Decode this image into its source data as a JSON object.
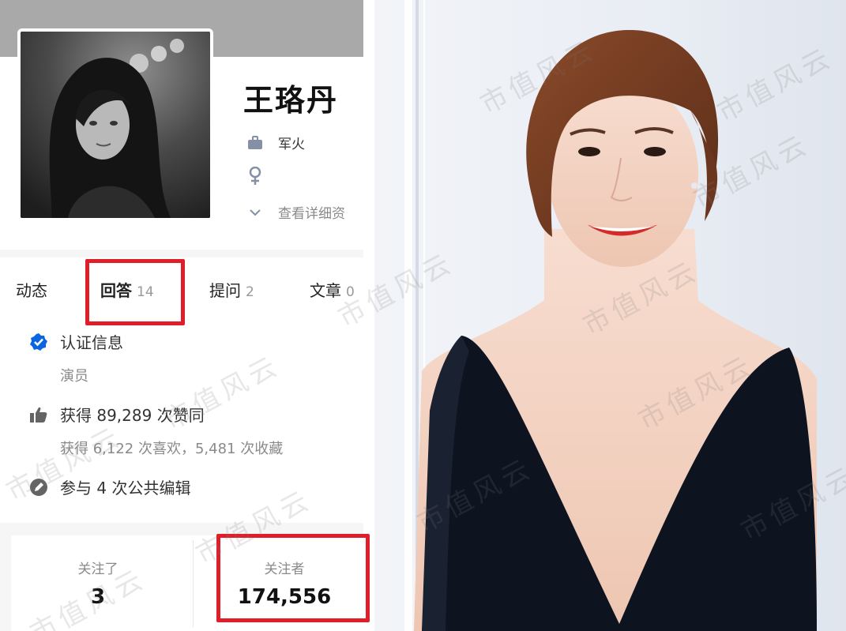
{
  "profile": {
    "name": "王珞丹",
    "job": "军火",
    "gender_icon": "female-icon",
    "more_info": "查看详细资",
    "avatar_desc": "black-and-white portrait"
  },
  "tabs": [
    {
      "label": "动态",
      "count": ""
    },
    {
      "label": "回答",
      "count": "14"
    },
    {
      "label": "提问",
      "count": "2"
    },
    {
      "label": "文章",
      "count": "0"
    }
  ],
  "details": {
    "verified_label": "认证信息",
    "verified_role": "演员",
    "likes": "获得 89,289 次赞同",
    "favorites": "获得 6,122 次喜欢，5,481 次收藏",
    "edits": "参与 4 次公共编辑"
  },
  "follow": {
    "following_label": "关注了",
    "following_count": "3",
    "followers_label": "关注者",
    "followers_count": "174,556"
  },
  "watermark_text": "市值风云",
  "colors": {
    "highlight": "#e01e2a",
    "verified_blue": "#0a66e0",
    "cover": "#a9a9a9"
  }
}
